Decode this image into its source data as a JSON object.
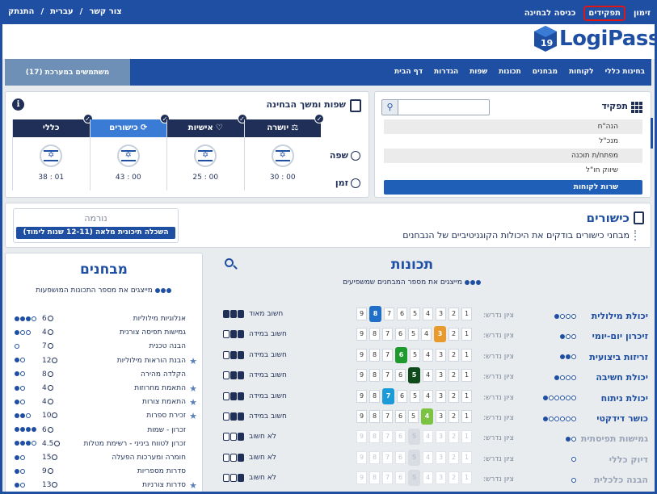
{
  "topbar": {
    "right_links": [
      "זימון",
      "תפקידים",
      "כניסה לבחינה"
    ],
    "highlighted": "תפקידים",
    "left_links": [
      "צור קשר",
      "/",
      "עברית",
      "/",
      "התנתק"
    ]
  },
  "logo": {
    "text": "LogiPass",
    "badge": "19"
  },
  "nav": {
    "items": [
      "בחינות כללי",
      "לקוחות",
      "מבחנים",
      "תכונות",
      "שפות",
      "הגדרות",
      "דף הבית"
    ],
    "users": "משתמשים במערכת (17)"
  },
  "roles": {
    "title": "תפקיד",
    "search_placeholder": "",
    "items": [
      "הנה\"ח",
      "מנכ\"ל",
      "מפתח/ת תוכנה",
      "שיווק חו\"ל",
      "שרות לקוחות"
    ],
    "selected": "שרות לקוחות"
  },
  "languages": {
    "title": "שפות ומשך הבחינה",
    "categories": [
      {
        "label": "כללי",
        "icon": "",
        "active": false,
        "time": "01 : 38"
      },
      {
        "label": "כישורים",
        "icon": "⟳",
        "active": true,
        "time": "00 : 43"
      },
      {
        "label": "אישיות",
        "icon": "♡",
        "active": false,
        "time": "00 : 25"
      },
      {
        "label": "יושרה",
        "icon": "⚖",
        "active": false,
        "time": "00 : 30"
      }
    ],
    "row_language": "שפה",
    "row_time": "זמן"
  },
  "intel": {
    "title": "כישורים",
    "description": "מבחני כישורים בודקים את היכולות הקוגניטיביים של הנבחנים",
    "norm_label": "נורמה",
    "norm_value": "השכלה תיכונית מלאה (12-11 שנות לימוד)"
  },
  "tests": {
    "title": "מבחנים",
    "subtitle": "מייצגים את מספר התכונות המושפעות",
    "rows": [
      {
        "name": "אנלוגיות מילוליות",
        "star": false,
        "num": "6",
        "filled": 3,
        "empty": 1
      },
      {
        "name": "גמישות תפיסה צורנית",
        "star": false,
        "num": "4",
        "filled": 1,
        "empty": 2
      },
      {
        "name": "הבנה טכנית",
        "star": false,
        "num": "7",
        "filled": 0,
        "empty": 1
      },
      {
        "name": "הבנת הוראות מילוליות",
        "star": true,
        "num": "12",
        "filled": 1,
        "empty": 1
      },
      {
        "name": "הקלדה מהירה",
        "star": false,
        "num": "8",
        "filled": 1,
        "empty": 1
      },
      {
        "name": "התאמת מחרוזות",
        "star": true,
        "num": "4",
        "filled": 1,
        "empty": 1
      },
      {
        "name": "התאמת צורות",
        "star": true,
        "num": "4",
        "filled": 1,
        "empty": 1
      },
      {
        "name": "זכירת ספרות",
        "star": true,
        "num": "10",
        "filled": 2,
        "empty": 1
      },
      {
        "name": "זכרון - שמות",
        "star": false,
        "num": "6",
        "filled": 4,
        "empty": 0
      },
      {
        "name": "זכרון לטווח ביניני - רשימת מטלות",
        "star": false,
        "num": "4.5",
        "filled": 3,
        "empty": 1
      },
      {
        "name": "חומרה ומערכות הפעלה",
        "star": false,
        "num": "15",
        "filled": 1,
        "empty": 1
      },
      {
        "name": "סדרות מספריות",
        "star": false,
        "num": "9",
        "filled": 1,
        "empty": 1
      },
      {
        "name": "סדרות צורניות",
        "star": true,
        "num": "13",
        "filled": 1,
        "empty": 1
      }
    ]
  },
  "traits": {
    "title": "תכונות",
    "subtitle": "מייצגים את מספר המבחנים שמשפיעים",
    "req_label": "ציון נדרש:",
    "scale": [
      "1",
      "2",
      "3",
      "4",
      "5",
      "6",
      "7",
      "8",
      "9"
    ],
    "rows": [
      {
        "name": "יכולת מילולית",
        "filled": 1,
        "empty": 3,
        "score": 8,
        "color": "#1f6fc9",
        "imp_label": "חשוב מאוד",
        "imp_filled": 3,
        "faded": false
      },
      {
        "name": "זיכרון יום-יומי",
        "filled": 1,
        "empty": 2,
        "score": 3,
        "color": "#e89a2c",
        "imp_label": "חשוב במידה",
        "imp_filled": 2,
        "faded": false
      },
      {
        "name": "זריזות ביצועית",
        "filled": 2,
        "empty": 1,
        "score": 6,
        "color": "#1e9a2e",
        "imp_label": "חשוב במידה",
        "imp_filled": 2,
        "faded": false
      },
      {
        "name": "יכולת חשיבה",
        "filled": 1,
        "empty": 3,
        "score": 5,
        "color": "#0f4a1a",
        "imp_label": "חשוב במידה",
        "imp_filled": 2,
        "faded": false
      },
      {
        "name": "יכולת ניתוח",
        "filled": 1,
        "empty": 5,
        "score": 7,
        "color": "#1b9bd8",
        "imp_label": "חשוב במידה",
        "imp_filled": 2,
        "faded": false
      },
      {
        "name": "כושר דידקטי",
        "filled": 1,
        "empty": 5,
        "score": 4,
        "color": "#7cc243",
        "imp_label": "חשוב במידה",
        "imp_filled": 2,
        "faded": false
      },
      {
        "name": "גמישות תפיסתית",
        "filled": 1,
        "empty": 1,
        "score": 5,
        "color": "#d9dde3",
        "imp_label": "לא חשוב",
        "imp_filled": 1,
        "faded": true
      },
      {
        "name": "דיוק כללי",
        "filled": 0,
        "empty": 1,
        "score": 5,
        "color": "#d9dde3",
        "imp_label": "לא חשוב",
        "imp_filled": 1,
        "faded": true
      },
      {
        "name": "הבנה כלכלית",
        "filled": 0,
        "empty": 1,
        "score": 5,
        "color": "#d9dde3",
        "imp_label": "לא חשוב",
        "imp_filled": 1,
        "faded": true
      }
    ]
  }
}
